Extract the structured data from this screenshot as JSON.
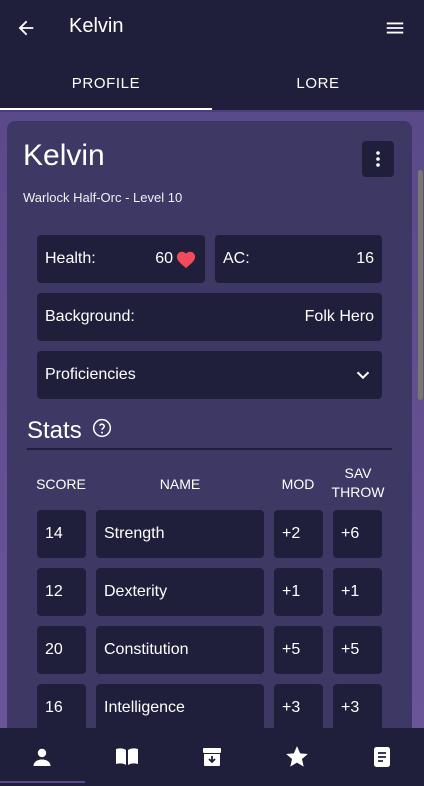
{
  "appbar": {
    "title": "Kelvin",
    "back_icon": "arrow-left-icon",
    "menu_icon": "hamburger-menu-icon"
  },
  "tabs": [
    {
      "label": "PROFILE",
      "active": true
    },
    {
      "label": "LORE",
      "active": false
    }
  ],
  "character": {
    "name": "Kelvin",
    "subtitle": "Warlock Half-Orc - Level 10",
    "health_label": "Health:",
    "health_value": "60",
    "ac_label": "AC:",
    "ac_value": "16",
    "background_label": "Background:",
    "background_value": "Folk Hero",
    "proficiencies_label": "Proficiencies"
  },
  "stats": {
    "title": "Stats",
    "headers": {
      "score": "SCORE",
      "name": "NAME",
      "mod": "MOD",
      "sav_throw": "SAV\nTHROW"
    },
    "rows": [
      {
        "score": "14",
        "name": "Strength",
        "mod": "+2",
        "save": "+6"
      },
      {
        "score": "12",
        "name": "Dexterity",
        "mod": "+1",
        "save": "+1"
      },
      {
        "score": "20",
        "name": "Constitution",
        "mod": "+5",
        "save": "+5"
      },
      {
        "score": "16",
        "name": "Intelligence",
        "mod": "+3",
        "save": "+3"
      }
    ]
  },
  "bottom_nav": [
    "person-icon",
    "book-icon",
    "archive-icon",
    "star-icon",
    "notes-icon"
  ],
  "colors": {
    "panel": "#1f1f3b",
    "card": "#3e3964",
    "heart": "#ef4b5c",
    "accent": "#5a4a8a"
  }
}
